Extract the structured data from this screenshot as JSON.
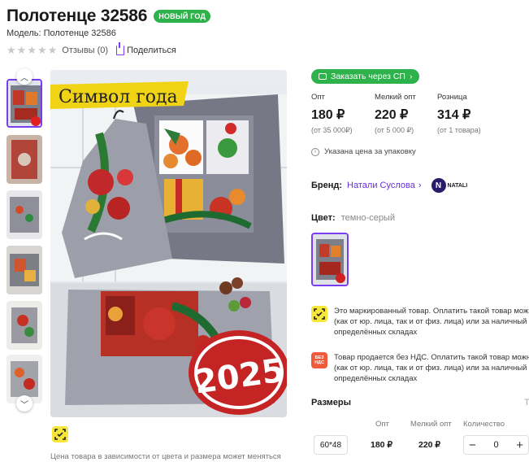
{
  "product": {
    "title": "Полотенце 32586",
    "badge": "НОВЫЙ ГОД",
    "model": "Модель: Полотенце 32586",
    "reviews": "Отзывы (0)",
    "share": "Поделиться"
  },
  "gallery": {
    "banner_text": "Символ года",
    "year_text": "2025",
    "disclaimer": "Цена товара в зависимости от цвета и размера может меняться"
  },
  "order": {
    "sp_button": "Заказать через СП"
  },
  "prices": [
    {
      "label": "Опт",
      "value": "180 ₽",
      "sub": "(от 35 000₽)"
    },
    {
      "label": "Мелкий опт",
      "value": "220 ₽",
      "sub": "(от 5 000 ₽)"
    },
    {
      "label": "Розница",
      "value": "314 ₽",
      "sub": "(от 1 товара)"
    }
  ],
  "note": "Указана цена за упаковку",
  "brand": {
    "label": "Бренд:",
    "name": "Натали Суслова",
    "logo_letter": "N",
    "logo_text": "NATALI"
  },
  "color": {
    "label": "Цвет:",
    "value": "темно-серый"
  },
  "info": {
    "marked_line1": "Это маркированный товар. Оплатить такой товар можн",
    "marked_line2": "(как от юр. лица, так и от физ. лица) или за наличный р",
    "marked_line3": "определённых складах",
    "nds_badge_line1": "БЕЗ",
    "nds_badge_line2": "НДС",
    "nds_line1": "Товар продается без НДС. Оплатить такой товар можн",
    "nds_line2": "(как от юр. лица, так и от физ. лица) или за наличный р",
    "nds_line3": "определённых складах"
  },
  "sizes": {
    "title": "Размеры",
    "more": "Т",
    "headers": {
      "opt": "Опт",
      "small_opt": "Мелкий опт",
      "qty": "Количество"
    },
    "row": {
      "size": "60*48",
      "opt": "180 ₽",
      "small_opt": "220 ₽",
      "qty": "0",
      "minus": "−",
      "plus": "+"
    }
  }
}
